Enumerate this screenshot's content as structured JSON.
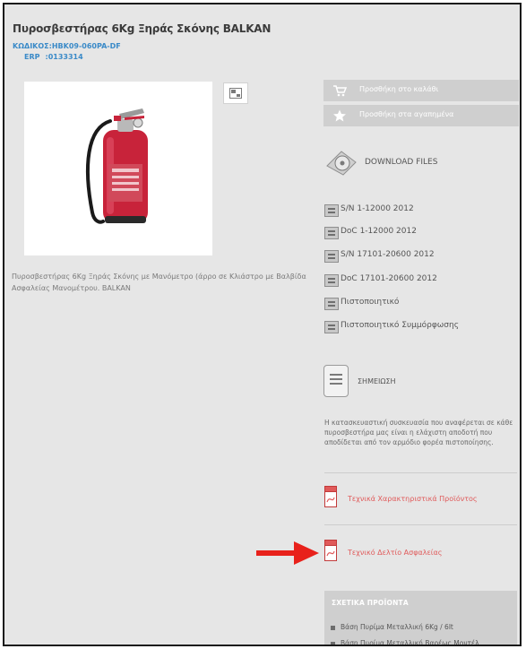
{
  "product": {
    "title": "Πυροσβεστήρας 6Kg Ξηράς Σκόνης BALKAN",
    "code_label": "ΚΩΔΙΚΟΣ:",
    "code_value": "HBK09-060PA-DF",
    "erp_label": "ERP",
    "erp_value": ":0133314",
    "description": "Πυροσβεστήρας 6Kg Ξηράς Σκόνης με Μανόμετρο (άρρο σε Κλιάστρο με Βαλβίδα Ασφαλείας Μανομέτρου. BALKAN",
    "zoom_icon": "zoom-icon"
  },
  "actions": {
    "add_to_cart": "Προσθήκη στο καλάθι",
    "add_to_favorites": "Προσθήκη στα αγαπημένα"
  },
  "downloads": {
    "header": "DOWNLOAD FILES",
    "items": [
      "S/N 1-12000 2012",
      "DoC 1-12000 2012",
      "S/N 17101-20600 2012",
      "DoC 17101-20600 2012",
      "Πιστοποιητικό",
      "Πιστοποιητικό Συμμόρφωσης"
    ]
  },
  "note": {
    "header": "ΣΗΜΕΙΩΣΗ",
    "text": "Η κατασκευαστική συσκευασία που αναφέρεται σε κάθε πυροσβεστήρα μας είναι η ελάχιστη αποδοτή που αποδίδεται από τον αρμόδιο φορέα πιστοποίησης."
  },
  "links": {
    "tech_specs": "Τεχνικά Χαρακτηριστικά Προϊόντος",
    "safety_sheet": "Τεχνικό Δελτίο Ασφαλείας"
  },
  "related": {
    "title": "ΣΧΕΤΙΚΑ ΠΡΟΪΟΝΤΑ",
    "items": [
      "Βάση Πυρίμα Μεταλλική 6Kg / 6lt",
      "Βάση Πυρίμα Μεταλλική Βαρέως Μοντέλ"
    ]
  },
  "colors": {
    "link_blue": "#3a8ac8",
    "pdf_red": "#e05a5a",
    "arrow_red": "#e8211b",
    "panel_grey": "#e6e6e6",
    "button_grey": "#cfcfcf"
  }
}
